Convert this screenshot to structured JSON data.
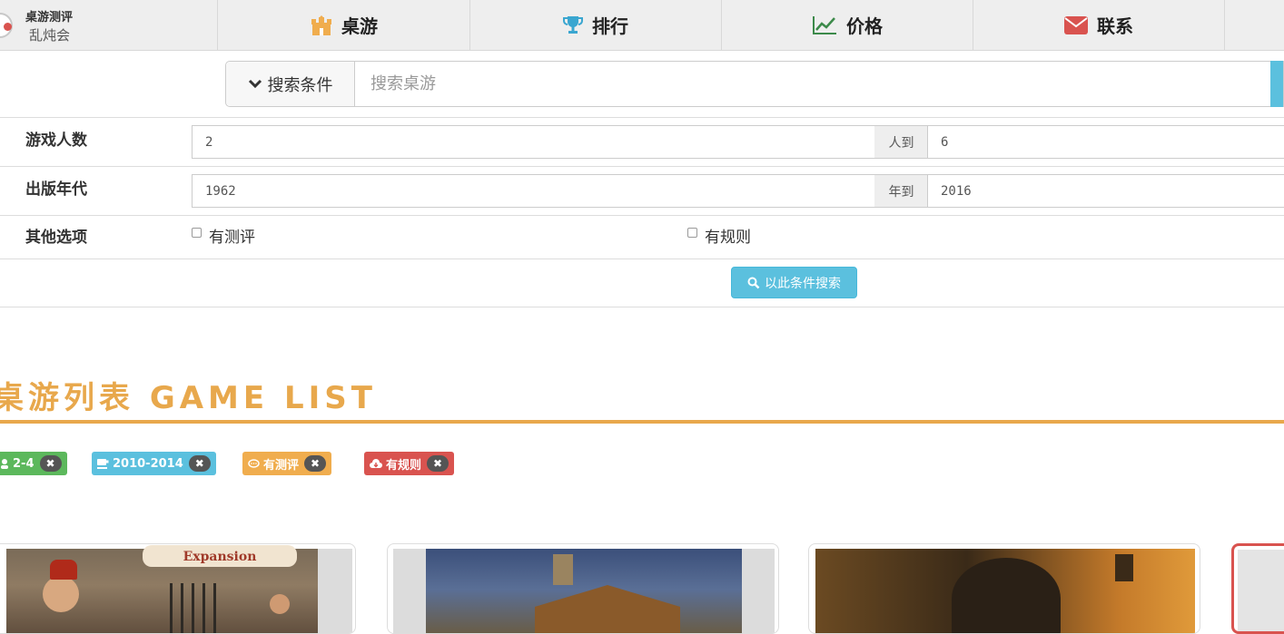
{
  "brand": {
    "title": "桌游测评",
    "subtitle": "乱炖会"
  },
  "nav": [
    {
      "label": "桌游",
      "icon": "castle-icon"
    },
    {
      "label": "排行",
      "icon": "trophy-icon"
    },
    {
      "label": "价格",
      "icon": "line-chart-icon"
    },
    {
      "label": "联系",
      "icon": "envelope-icon"
    }
  ],
  "search": {
    "condition_label": "搜索条件",
    "placeholder": "搜索桌游"
  },
  "filters": {
    "players": {
      "label": "游戏人数",
      "min": "2",
      "sep": "人到",
      "max": "6"
    },
    "years": {
      "label": "出版年代",
      "min": "1962",
      "sep": "年到",
      "max": "2016"
    },
    "other": {
      "label": "其他选项",
      "opt1": "有测评",
      "opt2": "有规则"
    },
    "submit": "以此条件搜索"
  },
  "game_list": {
    "title": "桌游列表 GAME LIST",
    "tags": [
      {
        "label": "2-4",
        "color": "#5cb85c"
      },
      {
        "label": "2010-2014",
        "color": "#5bc0de"
      },
      {
        "label": "有测评",
        "color": "#f0ad4e"
      },
      {
        "label": "有规则",
        "color": "#d9534f"
      }
    ],
    "banner_text": "Expansion"
  },
  "colors": {
    "accent": "#e8a84c",
    "info": "#5bc0de",
    "nav_bg": "#eeeeee"
  }
}
